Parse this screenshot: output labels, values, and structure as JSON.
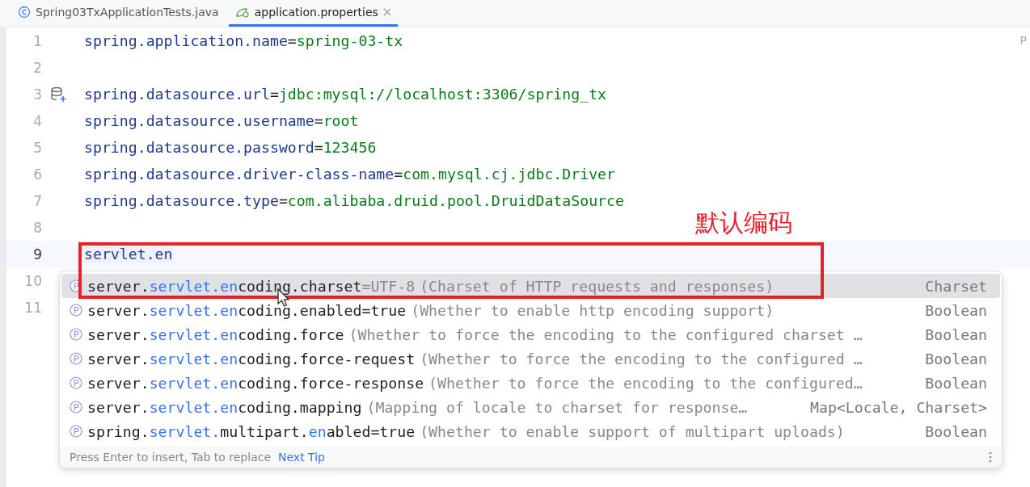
{
  "tabs": [
    {
      "label": "Spring03TxApplicationTests.java",
      "kind": "class",
      "selected": false,
      "closable": false
    },
    {
      "label": "application.properties",
      "kind": "properties",
      "selected": true,
      "closable": true
    }
  ],
  "right_edge_text": "P",
  "lines": [
    {
      "number": "1",
      "key": "spring.application.name",
      "sep": "=",
      "value": "spring-03-tx"
    },
    {
      "number": "2"
    },
    {
      "number": "3",
      "datasource_icon": true,
      "key": "spring.datasource.url",
      "sep": "=",
      "value": "jdbc:mysql://localhost:3306/spring_tx"
    },
    {
      "number": "4",
      "key": "spring.datasource.username",
      "sep": "=",
      "value": "root"
    },
    {
      "number": "5",
      "key": "spring.datasource.password",
      "sep": "=",
      "value": "123456"
    },
    {
      "number": "6",
      "key": "spring.datasource.driver-class-name",
      "sep": "=",
      "value": "com.mysql.cj.jdbc.Driver"
    },
    {
      "number": "7",
      "key": "spring.datasource.type",
      "sep": "=",
      "value": "com.alibaba.druid.pool.DruidDataSource"
    },
    {
      "number": "8"
    },
    {
      "number": "9",
      "current": true,
      "typed": "servlet.en"
    },
    {
      "number": "10"
    },
    {
      "number": "11"
    }
  ],
  "completion": {
    "items": [
      {
        "selected": true,
        "parts": [
          {
            "text": "server.",
            "kind": "plain"
          },
          {
            "text": "servlet.en",
            "kind": "match"
          },
          {
            "text": "coding.charset",
            "kind": "plain"
          },
          {
            "text": "=UTF-8",
            "kind": "hint"
          }
        ],
        "description": "(Charset of HTTP requests and responses)",
        "type": "Charset"
      },
      {
        "selected": false,
        "parts": [
          {
            "text": "server.",
            "kind": "plain"
          },
          {
            "text": "servlet.en",
            "kind": "match"
          },
          {
            "text": "coding.enabled=true",
            "kind": "plain"
          }
        ],
        "description": "(Whether to enable http encoding support)",
        "type": "Boolean"
      },
      {
        "selected": false,
        "parts": [
          {
            "text": "server.",
            "kind": "plain"
          },
          {
            "text": "servlet.en",
            "kind": "match"
          },
          {
            "text": "coding.force",
            "kind": "plain"
          }
        ],
        "description": "(Whether to force the encoding to the configured charset …",
        "type": "Boolean"
      },
      {
        "selected": false,
        "parts": [
          {
            "text": "server.",
            "kind": "plain"
          },
          {
            "text": "servlet.en",
            "kind": "match"
          },
          {
            "text": "coding.force-request",
            "kind": "plain"
          }
        ],
        "description": "(Whether to force the encoding to the configured …",
        "type": "Boolean"
      },
      {
        "selected": false,
        "parts": [
          {
            "text": "server.",
            "kind": "plain"
          },
          {
            "text": "servlet.en",
            "kind": "match"
          },
          {
            "text": "coding.force-response",
            "kind": "plain"
          }
        ],
        "description": "(Whether to force the encoding to the configured…",
        "type": "Boolean"
      },
      {
        "selected": false,
        "parts": [
          {
            "text": "server.",
            "kind": "plain"
          },
          {
            "text": "servlet.en",
            "kind": "match"
          },
          {
            "text": "coding.mapping",
            "kind": "plain"
          }
        ],
        "description": "(Mapping of locale to charset for response…",
        "type": "Map<Locale, Charset>"
      },
      {
        "selected": false,
        "parts": [
          {
            "text": "spring.",
            "kind": "plain"
          },
          {
            "text": "servlet.",
            "kind": "match"
          },
          {
            "text": "multipart.",
            "kind": "plain"
          },
          {
            "text": "en",
            "kind": "match"
          },
          {
            "text": "abled=true",
            "kind": "plain"
          }
        ],
        "description": "(Whether to enable support of multipart uploads)",
        "type": "Boolean"
      }
    ],
    "hint": "Press Enter to insert, Tab to replace",
    "next_tip": "Next Tip"
  },
  "annotation": {
    "label": "默认编码",
    "color": "#e8202a"
  }
}
